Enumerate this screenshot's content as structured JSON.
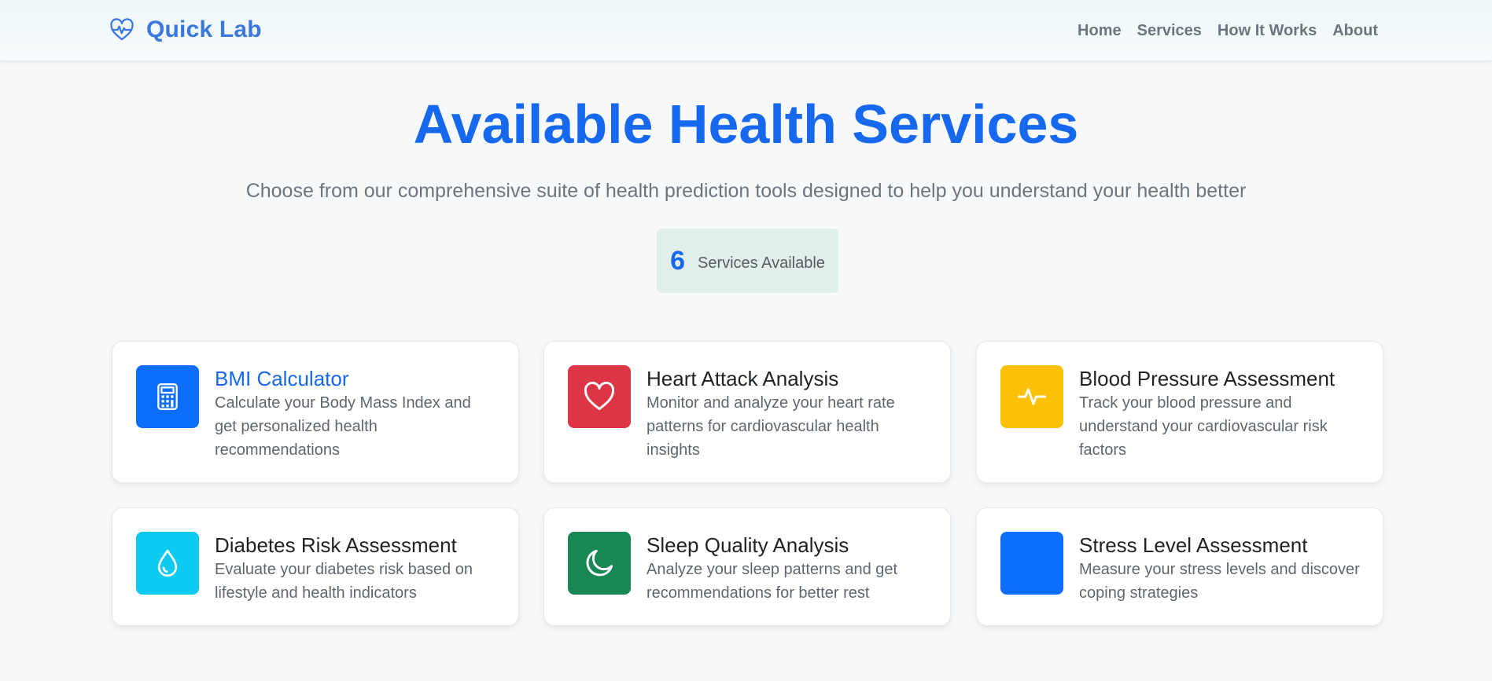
{
  "brand": {
    "name": "Quick Lab",
    "icon": "heart-pulse-icon",
    "color": "#3a78dd"
  },
  "nav": {
    "items": [
      {
        "label": "Home"
      },
      {
        "label": "Services"
      },
      {
        "label": "How It Works"
      },
      {
        "label": "About"
      }
    ]
  },
  "hero": {
    "title": "Available Health Services",
    "subtitle": "Choose from our comprehensive suite of health prediction tools designed to help you understand your health better"
  },
  "stats": {
    "count": "6",
    "label": "Services Available"
  },
  "services": [
    {
      "title": "BMI Calculator",
      "description": "Calculate your Body Mass Index and get personalized health recommendations",
      "icon": "calculator-icon",
      "color": "#0d6efd"
    },
    {
      "title": "Heart Attack Analysis",
      "description": "Monitor and analyze your heart rate patterns for cardiovascular health insights",
      "icon": "heart-icon",
      "color": "#dc3545"
    },
    {
      "title": "Blood Pressure Assessment",
      "description": "Track your blood pressure and understand your cardiovascular risk factors",
      "icon": "pulse-icon",
      "color": "#ffc107"
    },
    {
      "title": "Diabetes Risk Assessment",
      "description": "Evaluate your diabetes risk based on lifestyle and health indicators",
      "icon": "droplet-icon",
      "color": "#0dcaf0"
    },
    {
      "title": "Sleep Quality Analysis",
      "description": "Analyze your sleep patterns and get recommendations for better rest",
      "icon": "moon-icon",
      "color": "#198754"
    },
    {
      "title": "Stress Level Assessment",
      "description": "Measure your stress levels and discover coping strategies",
      "icon": "blank-icon",
      "color": "#0d6efd"
    }
  ]
}
